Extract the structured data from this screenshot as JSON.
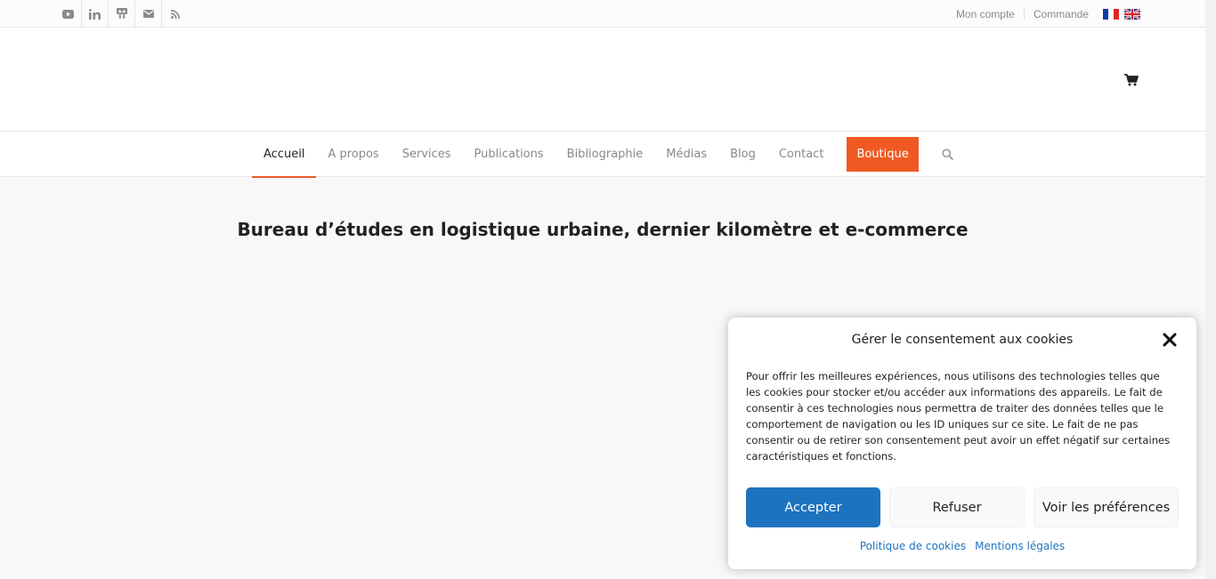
{
  "topbar": {
    "social_icons": [
      "youtube-icon",
      "linkedin-icon",
      "slideshare-icon",
      "mail-icon",
      "rss-icon"
    ],
    "links": [
      "Mon compte",
      "Commande"
    ],
    "languages": [
      "fr-flag-icon",
      "en-flag-icon"
    ]
  },
  "nav": {
    "items": [
      "Accueil",
      "A propos",
      "Services",
      "Publications",
      "Bibliographie",
      "Médias",
      "Blog",
      "Contact"
    ],
    "active": "Accueil",
    "shop_label": "Boutique",
    "accent_color": "#f05a22"
  },
  "main": {
    "headline": "Bureau d’études en logistique urbaine, dernier kilomètre et e-commerce"
  },
  "cookie_dialog": {
    "title": "Gérer le consentement aux cookies",
    "body": "Pour offrir les meilleures expériences, nous utilisons des technologies telles que les cookies pour stocker et/ou accéder aux informations des appareils. Le fait de consentir à ces technologies nous permettra de traiter des données telles que le comportement de navigation ou les ID uniques sur ce site. Le fait de ne pas consentir ou de retirer son consentement peut avoir un effet négatif sur certaines caractéristiques et fonctions.",
    "accept": "Accepter",
    "refuse": "Refuser",
    "preferences": "Voir les préférences",
    "links": [
      "Politique de cookies",
      "Mentions légales"
    ],
    "accept_color": "#1e73be"
  }
}
